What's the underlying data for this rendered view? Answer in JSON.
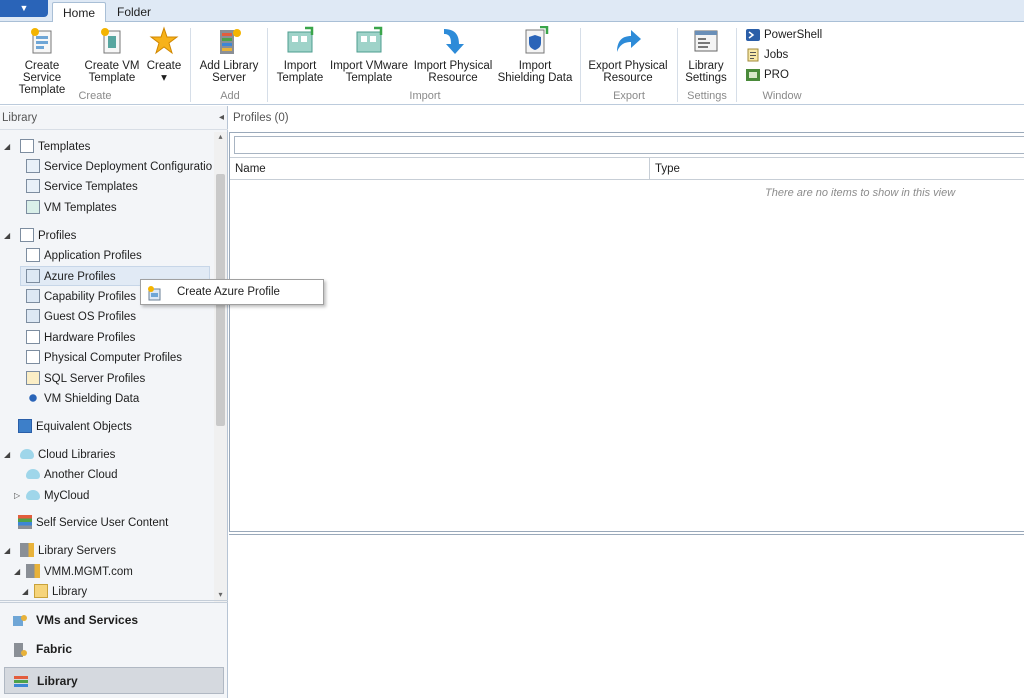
{
  "ribbon_tabs": {
    "file_glyph": "▼",
    "home": "Home",
    "folder": "Folder"
  },
  "ribbon": {
    "create_service_template": [
      "Create Service",
      "Template"
    ],
    "create_vm_template": [
      "Create VM",
      "Template"
    ],
    "create": [
      "Create",
      "▾"
    ],
    "add_library_server": [
      "Add Library",
      "Server"
    ],
    "import_template": [
      "Import",
      "Template"
    ],
    "import_vmware_template": [
      "Import VMware",
      "Template"
    ],
    "import_physical_resource": [
      "Import Physical",
      "Resource"
    ],
    "import_shielding_data": [
      "Import",
      "Shielding Data"
    ],
    "export_physical_resource": [
      "Export Physical",
      "Resource"
    ],
    "library_settings": [
      "Library",
      "Settings"
    ],
    "powershell": "PowerShell",
    "jobs": "Jobs",
    "pro": "PRO",
    "groups": {
      "create": "Create",
      "add": "Add",
      "import": "Import",
      "export": "Export",
      "settings": "Settings",
      "window": "Window"
    }
  },
  "left_pane": {
    "header": "Library",
    "collapse_glyph": "◂",
    "tree": {
      "templates": "Templates",
      "service_deployment": "Service Deployment Configuratio",
      "service_templates": "Service Templates",
      "vm_templates": "VM Templates",
      "profiles": "Profiles",
      "application_profiles": "Application Profiles",
      "azure_profiles": "Azure Profiles",
      "capability_profiles": "Capability Profiles",
      "guest_os_profiles": "Guest OS Profiles",
      "hardware_profiles": "Hardware Profiles",
      "physical_computer_profiles": "Physical Computer Profiles",
      "sql_server_profiles": "SQL Server Profiles",
      "vm_shielding_data": "VM Shielding Data",
      "equivalent_objects": "Equivalent Objects",
      "cloud_libraries": "Cloud Libraries",
      "another_cloud": "Another Cloud",
      "mycloud": "MyCloud",
      "self_service": "Self Service User Content",
      "library_servers": "Library Servers",
      "vmm_mgmt": "VMM.MGMT.com",
      "library": "Library"
    },
    "wunderbar": {
      "vms": "VMs and Services",
      "fabric": "Fabric",
      "library": "Library"
    }
  },
  "context_menu": {
    "create_azure_profile": "Create Azure Profile"
  },
  "main": {
    "title": "Profiles (0)",
    "columns": {
      "name": "Name",
      "type": "Type"
    },
    "empty_text": "There are no items to show in this view"
  },
  "colors": {
    "accent": "#2a64b8",
    "ribbon_tab_bg": "#dfe9f5",
    "selection": "#e1eaf5"
  }
}
